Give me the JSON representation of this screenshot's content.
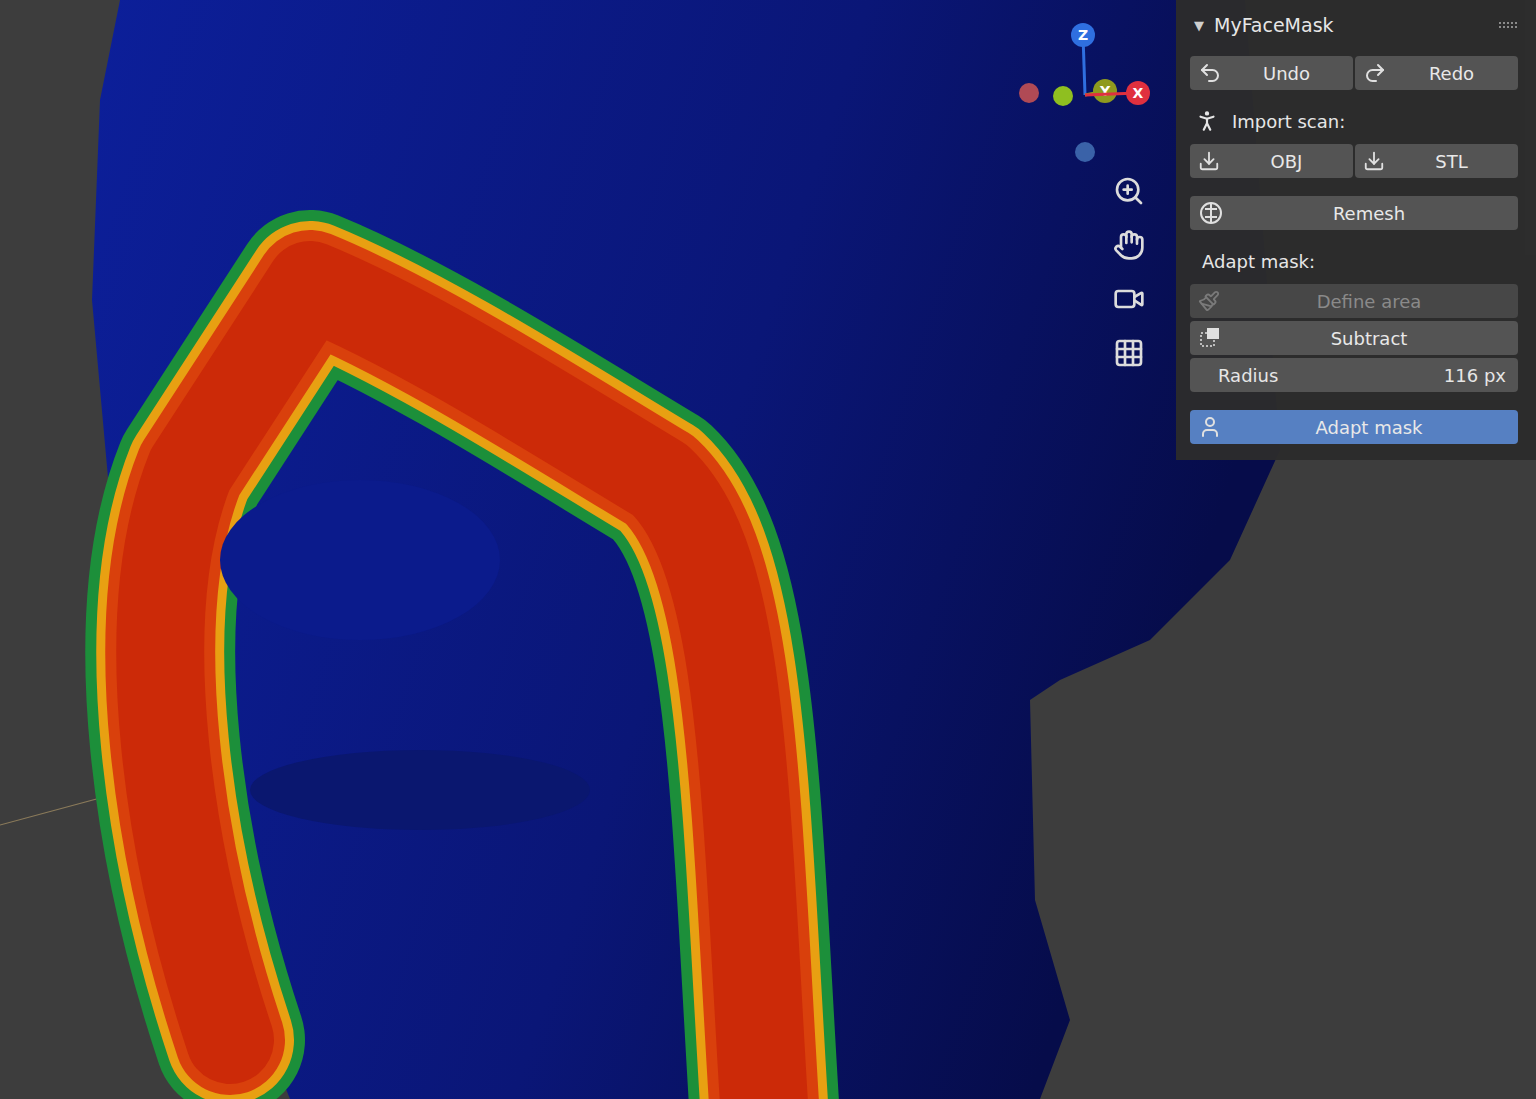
{
  "viewport": {
    "gizmo": [
      {
        "label": "Z",
        "color": "#2f6fe0"
      },
      {
        "label": "Y",
        "color": "#8f9a1e"
      },
      {
        "label": "X",
        "color": "#e0303f"
      }
    ]
  },
  "panel": {
    "title": "MyFaceMask",
    "collapse_icon": "▼",
    "expanded": true,
    "history": [
      {
        "label": "Undo"
      },
      {
        "label": "Redo"
      }
    ],
    "import": {
      "label": "Import scan:",
      "buttons": [
        {
          "label": "OBJ"
        },
        {
          "label": "STL"
        }
      ]
    },
    "remesh": {
      "label": "Remesh"
    },
    "adapt": {
      "label": "Adapt mask:",
      "tools": [
        {
          "label": "Define area",
          "disabled": true
        },
        {
          "label": "Subtract",
          "disabled": false
        }
      ],
      "radius": {
        "label": "Radius",
        "value": "116 px"
      },
      "action": {
        "label": "Adapt mask",
        "selected": true
      }
    }
  }
}
